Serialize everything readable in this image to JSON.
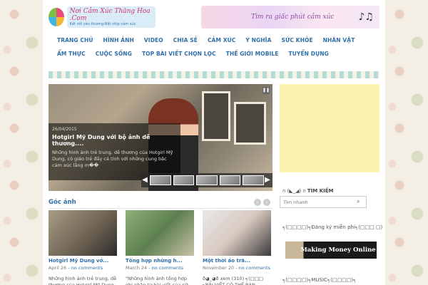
{
  "header": {
    "logo_title": "Nơi Cảm Xúc Thăng Hoa .Com",
    "logo_sub": "Kết nối yêu thương-Bất nhịp cảm xúc",
    "banner_text": "Tìm ra giấc phút cảm xúc"
  },
  "nav": [
    "TRANG CHỦ",
    "HÌNH ẢNH",
    "VIDEO",
    "CHIA SẺ",
    "CẢM XÚC",
    "Ý NGHĨA",
    "SỨC KHỎE",
    "NHÂN VẬT",
    "ẨM THỰC",
    "CUỘC SỐNG",
    "TOP BÀI VIẾT CHỌN LỌC",
    "THẾ GIỚI MOBILE",
    "TUYỂN DỤNG"
  ],
  "slider": {
    "date": "26/04/2015",
    "title": "Hotgirl Mỹ Dung với bộ ảnh dễ thương....",
    "desc": "Những hình ảnh trẻ trung, dễ thương của Hotgirl Mỹ Dung, cô giáo trẻ đầy cá tính với những cung bậc cảm xúc lắng m��"
  },
  "section": {
    "title": "Góc ảnh",
    "cards": [
      {
        "title": "Hotgirl Mỹ Dung vớ...",
        "date": "April 26",
        "comments": "no comments",
        "desc": "Những hình ảnh trẻ trung, dễ thương của Hotgirl Mỹ Dung,"
      },
      {
        "title": "Tổng hợp những h...",
        "date": "March 24",
        "comments": "no comments",
        "desc": "\"Những hình ảnh tổng hợp ghi nhận  từ bài viết của nữ"
      },
      {
        "title": "Một thời áo trắ...",
        "date": "November 20",
        "comments": "no comments",
        "desc": "ð◕_◕ð xem (310) ╕(□□□ ╕BÀI VIẾT CÓ THỂ BẠN"
      }
    ]
  },
  "sidebar": {
    "search_heading_sym": "ก (◣_◢) ก",
    "search_heading": "TÌM KIẾM",
    "search_placeholder": "Tìm nhanh",
    "signup_heading": "╕(□□□□)╕Đăng ký miễn phí╕(□□□ □)",
    "money_banner": "Making Money Online",
    "music_heading": "╕(□□□□)╕MUSIC╕(□□□□)╕"
  }
}
